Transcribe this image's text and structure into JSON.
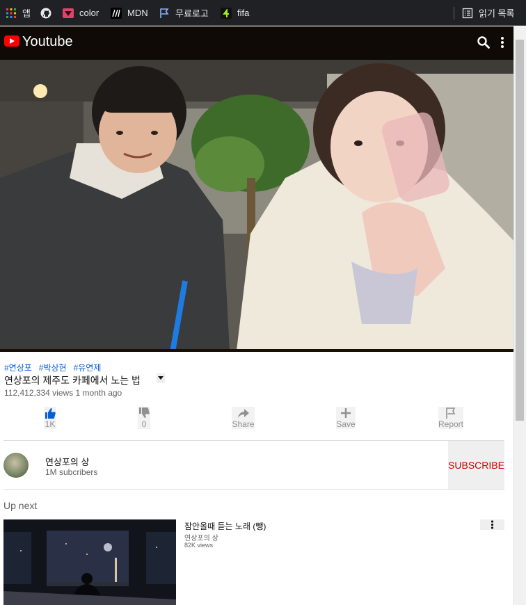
{
  "bookmarks": [
    {
      "label": "앱",
      "icon": "apps-grid-icon"
    },
    {
      "label": "",
      "icon": "github-icon"
    },
    {
      "label": "color",
      "icon": "color-bookmark-icon"
    },
    {
      "label": "MDN",
      "icon": "mdn-icon"
    },
    {
      "label": "무료로고",
      "icon": "flag-bookmark-icon"
    },
    {
      "label": "fifa",
      "icon": "fifa-icon"
    }
  ],
  "reading_list": {
    "label": "읽기 목록",
    "icon": "reading-list-icon"
  },
  "header": {
    "title": "Youtube",
    "brand_color": "#ff0000"
  },
  "video": {
    "tags": [
      "#연상포",
      "#박상현",
      "#유연제"
    ],
    "title": "연상포의 제주도 카페에서 노는 법",
    "meta": "112,412,334 views 1 month ago"
  },
  "actions": {
    "like": {
      "label": "1K",
      "icon": "thumbs-up-icon",
      "active_color": "#065fd4"
    },
    "dislike": {
      "label": "0",
      "icon": "thumbs-down-icon"
    },
    "share": {
      "label": "Share",
      "icon": "share-arrow-icon"
    },
    "save": {
      "label": "Save",
      "icon": "plus-icon"
    },
    "report": {
      "label": "Report",
      "icon": "flag-icon"
    }
  },
  "channel": {
    "name": "연상포의 상",
    "subscribers": "1M subcribers",
    "subscribe_label": "SUBSCRIBE"
  },
  "up_next": {
    "heading": "Up next",
    "items": [
      {
        "title": "잠안올때 듣는 노래 (뺑)",
        "channel": "연상포의 상",
        "views": "82K views"
      }
    ]
  }
}
